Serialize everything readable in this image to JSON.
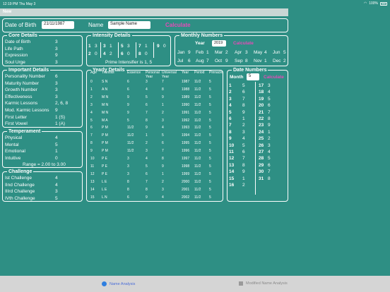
{
  "status_bar": {
    "time": "12:19 PM  Thu May 3",
    "battery": "100%"
  },
  "nav": {
    "title": "New"
  },
  "header": {
    "dob_label": "Date of Birth",
    "dob_value": "21/11/1987",
    "name_label": "Name",
    "name_value": "Sample Name",
    "calculate": "Calculate"
  },
  "core": {
    "title": "Core Details",
    "rows": [
      {
        "label": "Date of Birth",
        "value": "3"
      },
      {
        "label": "Life Path",
        "value": "3"
      },
      {
        "label": "Expression",
        "value": "9"
      },
      {
        "label": "Soul Urge",
        "value": "3"
      }
    ]
  },
  "intensity": {
    "title": "Intensity Details",
    "row1": [
      {
        "n": "1",
        "v": "3"
      },
      {
        "n": "3",
        "v": "1"
      },
      {
        "n": "5",
        "v": "3"
      },
      {
        "n": "7",
        "v": "1"
      },
      {
        "n": "9",
        "v": "0"
      }
    ],
    "row2": [
      {
        "n": "2",
        "v": "0"
      },
      {
        "n": "4",
        "v": "2"
      },
      {
        "n": "6",
        "v": "0"
      },
      {
        "n": "8",
        "v": "0"
      }
    ],
    "prime": "Prime Intensifier is 1, 5"
  },
  "monthly": {
    "title": "Monthly Numbers",
    "year_label": "Year",
    "year_value": "2019",
    "calculate": "Calculate",
    "row1": [
      {
        "m": "Jan",
        "v": "9"
      },
      {
        "m": "Feb",
        "v": "1"
      },
      {
        "m": "Mar",
        "v": "2"
      },
      {
        "m": "Apr",
        "v": "3"
      },
      {
        "m": "May",
        "v": "4"
      },
      {
        "m": "Jun",
        "v": "5"
      }
    ],
    "row2": [
      {
        "m": "Jul",
        "v": "6"
      },
      {
        "m": "Aug",
        "v": "7"
      },
      {
        "m": "Oct",
        "v": "9"
      },
      {
        "m": "Sep",
        "v": "8"
      },
      {
        "m": "Nov",
        "v": "1"
      },
      {
        "m": "Dec",
        "v": "2"
      }
    ]
  },
  "important": {
    "title": "Important Details",
    "rows": [
      {
        "label": "Personality Number",
        "value": "6"
      },
      {
        "label": "Maturity Number",
        "value": "3"
      },
      {
        "label": "Growth Number",
        "value": "3"
      },
      {
        "label": "Effectiveness",
        "value": "3"
      },
      {
        "label": "Karmic Lessons",
        "value": "2, 6, 8"
      },
      {
        "label": "Mod. Karmic Lessons",
        "value": "9"
      },
      {
        "label": "First Letter",
        "value": "1 (S)"
      },
      {
        "label": "First Vowel",
        "value": "1 (A)"
      }
    ]
  },
  "temperament": {
    "title": "Temperament",
    "rows": [
      {
        "label": "Physical",
        "value": "4"
      },
      {
        "label": "Mental",
        "value": "5"
      },
      {
        "label": "Emotional",
        "value": "1"
      },
      {
        "label": "Intuitive",
        "value": "0"
      }
    ],
    "range": "Range = 2.00 to 3.00"
  },
  "challenge": {
    "title": "Challenge",
    "rows": [
      {
        "label": "Ist Challenge",
        "value": "4"
      },
      {
        "label": "IInd Challenge",
        "value": "4"
      },
      {
        "label": "IIIrd Challenge",
        "value": "3"
      },
      {
        "label": "IVth Challenge",
        "value": "5"
      }
    ]
  },
  "yearly": {
    "title": "Yearly Details",
    "headers": [
      "Age",
      "Transits",
      "Essence",
      "Personal Year",
      "Universal Year",
      "Year",
      "Period",
      "Pinnacle"
    ],
    "rows": [
      [
        "0",
        "S N",
        "6",
        "3",
        "7",
        "1987",
        "11/2",
        "5"
      ],
      [
        "1",
        "A N",
        "6",
        "4",
        "8",
        "1988",
        "11/2",
        "5"
      ],
      [
        "2",
        "M N",
        "9",
        "5",
        "9",
        "1989",
        "11/2",
        "5"
      ],
      [
        "3",
        "M N",
        "9",
        "6",
        "1",
        "1990",
        "11/2",
        "5"
      ],
      [
        "4",
        "M N",
        "9",
        "7",
        "2",
        "1991",
        "11/2",
        "5"
      ],
      [
        "5",
        "M A",
        "5",
        "8",
        "3",
        "1992",
        "11/2",
        "5"
      ],
      [
        "6",
        "P M",
        "11/2",
        "9",
        "4",
        "1993",
        "11/2",
        "5"
      ],
      [
        "7",
        "P M",
        "11/2",
        "1",
        "5",
        "1994",
        "11/2",
        "5"
      ],
      [
        "8",
        "P M",
        "11/2",
        "2",
        "6",
        "1995",
        "11/2",
        "5"
      ],
      [
        "9",
        "P M",
        "11/2",
        "3",
        "7",
        "1996",
        "11/2",
        "5"
      ],
      [
        "10",
        "P E",
        "3",
        "4",
        "8",
        "1997",
        "11/2",
        "5"
      ],
      [
        "11",
        "P E",
        "3",
        "5",
        "9",
        "1998",
        "11/2",
        "5"
      ],
      [
        "12",
        "P E",
        "3",
        "6",
        "1",
        "1999",
        "11/2",
        "5"
      ],
      [
        "13",
        "L E",
        "8",
        "7",
        "2",
        "2000",
        "11/2",
        "5"
      ],
      [
        "14",
        "L E",
        "8",
        "8",
        "3",
        "2001",
        "11/2",
        "5"
      ],
      [
        "15",
        "L N",
        "6",
        "9",
        "4",
        "2002",
        "11/2",
        "5"
      ]
    ]
  },
  "date_numbers": {
    "title": "Date Numbers",
    "month_label": "Month",
    "month_value": "5",
    "calculate": "Calculate",
    "col1": [
      {
        "d": "1",
        "v": "5"
      },
      {
        "d": "2",
        "v": "6"
      },
      {
        "d": "3",
        "v": "7"
      },
      {
        "d": "4",
        "v": "8"
      },
      {
        "d": "5",
        "v": "9"
      },
      {
        "d": "6",
        "v": "1"
      },
      {
        "d": "7",
        "v": "2"
      },
      {
        "d": "8",
        "v": "3"
      },
      {
        "d": "9",
        "v": "4"
      },
      {
        "d": "10",
        "v": "5"
      },
      {
        "d": "11",
        "v": "6"
      },
      {
        "d": "12",
        "v": "7"
      },
      {
        "d": "13",
        "v": "8"
      },
      {
        "d": "14",
        "v": "9"
      },
      {
        "d": "15",
        "v": "1"
      },
      {
        "d": "16",
        "v": "2"
      }
    ],
    "col2": [
      {
        "d": "17",
        "v": "3"
      },
      {
        "d": "18",
        "v": "4"
      },
      {
        "d": "19",
        "v": "5"
      },
      {
        "d": "20",
        "v": "6"
      },
      {
        "d": "21",
        "v": "7"
      },
      {
        "d": "22",
        "v": "8"
      },
      {
        "d": "23",
        "v": "9"
      },
      {
        "d": "24",
        "v": "1"
      },
      {
        "d": "25",
        "v": "2"
      },
      {
        "d": "26",
        "v": "3"
      },
      {
        "d": "27",
        "v": "4"
      },
      {
        "d": "28",
        "v": "5"
      },
      {
        "d": "29",
        "v": "6"
      },
      {
        "d": "30",
        "v": "7"
      },
      {
        "d": "31",
        "v": "8"
      }
    ]
  },
  "tabs": [
    {
      "label": "Name Analysis",
      "active": true,
      "icon": "circle-icon"
    },
    {
      "label": "Modified Name Analysis",
      "active": false,
      "icon": "square-icon"
    }
  ],
  "colors": {
    "background": "#2e8f84",
    "accent": "#e64bb8",
    "tab_active": "#4a6dd8"
  }
}
